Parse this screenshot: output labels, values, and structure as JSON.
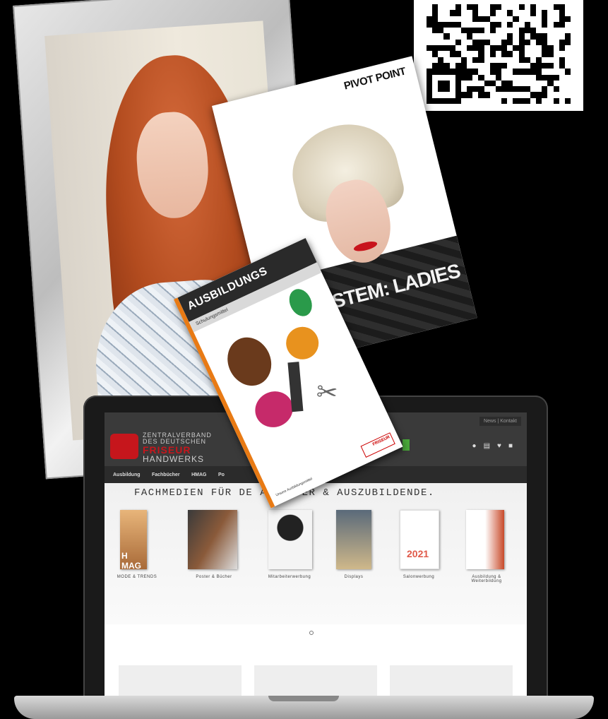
{
  "booklet_pivot": {
    "brand": "PIVOT POINT",
    "title": "CUT SYSTEM: LADIES"
  },
  "booklet_ausbildung": {
    "title": "AUSBILDUNGS",
    "subtitle": "Schulungsmittel",
    "footer": "Unsere Ausbildungsmittel",
    "logo": "FRISEUR"
  },
  "site": {
    "logo": {
      "line1": "ZENTRALVERBAND",
      "line2": "DES DEUTSCHEN",
      "line3": "FRISEUR",
      "line4": "HANDWERKS"
    },
    "toplinks": "News | Kontakt",
    "nav": [
      "Ausbildung",
      "Fachbücher",
      "HMAG",
      "Po"
    ],
    "headline": "FACHMEDIEN FÜR DE          ARBEITER & AUSZUBILDENDE.",
    "categories": [
      {
        "label": "MODE & TRENDS",
        "image_text": "H MAG"
      },
      {
        "label": "Poster & Bücher",
        "image_text": ""
      },
      {
        "label": "Mitarbeiterwerbung",
        "image_text": ""
      },
      {
        "label": "Displays",
        "image_text": ""
      },
      {
        "label": "Salonwerbung",
        "image_text": "2021"
      },
      {
        "label": "Ausbildung & Weiterbildung",
        "image_text": ""
      }
    ],
    "icons": [
      "user-icon",
      "list-icon",
      "heart-icon",
      "cart-icon"
    ],
    "colors": {
      "brand_red": "#c6161c",
      "header": "#3a3a3a",
      "accent_green": "#4aa83a"
    }
  }
}
